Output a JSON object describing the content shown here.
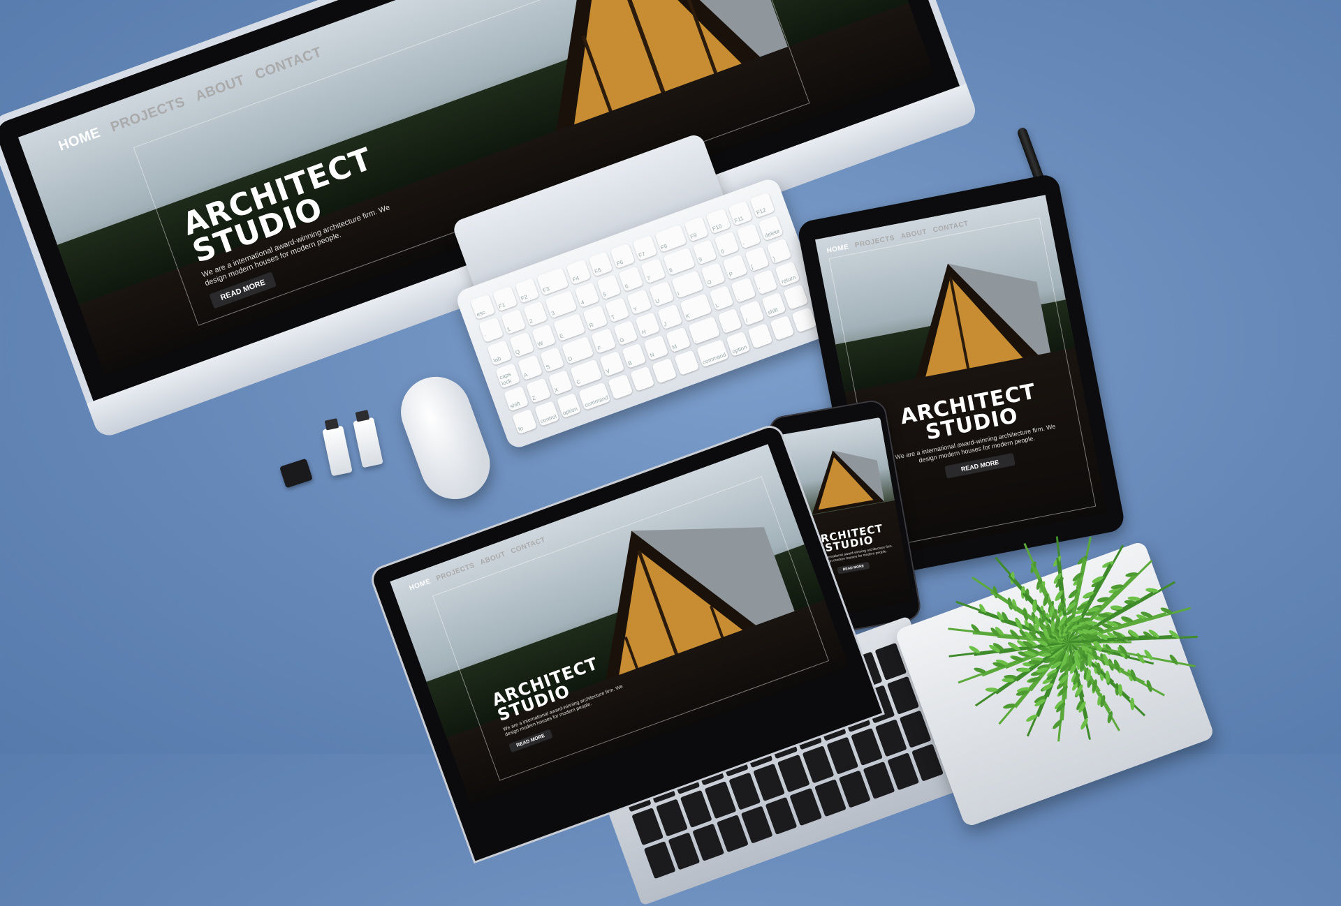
{
  "site": {
    "nav": {
      "home": "HOME",
      "projects": "PROJECTS",
      "about": "ABOUT",
      "contact": "CONTACT"
    },
    "hero": {
      "title": "ARCHITECT\nSTUDIO",
      "description": "We are a international award-winning architecture firm. We design modern houses for modern people.",
      "button_label": "READ MORE"
    }
  },
  "keyboard": {
    "keys": [
      "esc",
      "F1",
      "F2",
      "F3",
      "F4",
      "F5",
      "F6",
      "F7",
      "F8",
      "F9",
      "F10",
      "F11",
      "F12",
      "`",
      "1",
      "2",
      "3",
      "4",
      "5",
      "6",
      "7",
      "8",
      "9",
      "0",
      "-",
      "delete",
      "tab",
      "Q",
      "W",
      "E",
      "R",
      "T",
      "Y",
      "U",
      "I",
      "O",
      "P",
      "[",
      "]",
      "caps lock",
      "A",
      "S",
      "D",
      "F",
      "G",
      "H",
      "J",
      "K",
      "L",
      ";",
      "'",
      "return",
      "shift",
      "Z",
      "X",
      "C",
      "V",
      "B",
      "N",
      "M",
      ",",
      ".",
      "/",
      "shift",
      "",
      "fn",
      "control",
      "option",
      "command",
      "",
      "",
      "",
      "",
      "command",
      "option",
      "",
      "",
      ""
    ]
  },
  "colors": {
    "background": "#6688b8",
    "screen_dark": "#120f10",
    "cabin_glow": "#e8a33a"
  }
}
